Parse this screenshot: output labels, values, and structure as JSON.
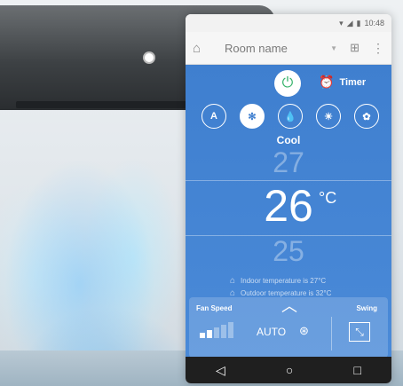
{
  "status": {
    "time": "10:48",
    "signal_icon": "signal-icon",
    "battery_icon": "battery-icon"
  },
  "appbar": {
    "home_icon": "home-icon",
    "room_name": "Room name",
    "dropdown_icon": "dropdown-icon",
    "add_icon": "add-device-icon",
    "more_icon": "more-icon"
  },
  "controls": {
    "power_icon": "power-icon",
    "timer_label": "Timer",
    "modes": [
      {
        "name": "auto",
        "glyph": "A"
      },
      {
        "name": "cool",
        "glyph": "✻"
      },
      {
        "name": "dry",
        "glyph": "💧"
      },
      {
        "name": "heat",
        "glyph": "☀"
      },
      {
        "name": "fan",
        "glyph": "✿"
      }
    ],
    "mode_label": "Cool"
  },
  "temperature": {
    "above": "27",
    "current": "26",
    "unit": "°C",
    "below": "25"
  },
  "info": {
    "indoor": "Indoor temperature is   27°C",
    "outdoor": "Outdoor temperature is   32°C"
  },
  "panel": {
    "fan_label": "Fan Speed",
    "fan_value": "AUTO",
    "swing_label": "Swing",
    "fan_level": 0.4
  },
  "colors": {
    "primary": "#3f7fcf",
    "power": "#35b26a"
  }
}
